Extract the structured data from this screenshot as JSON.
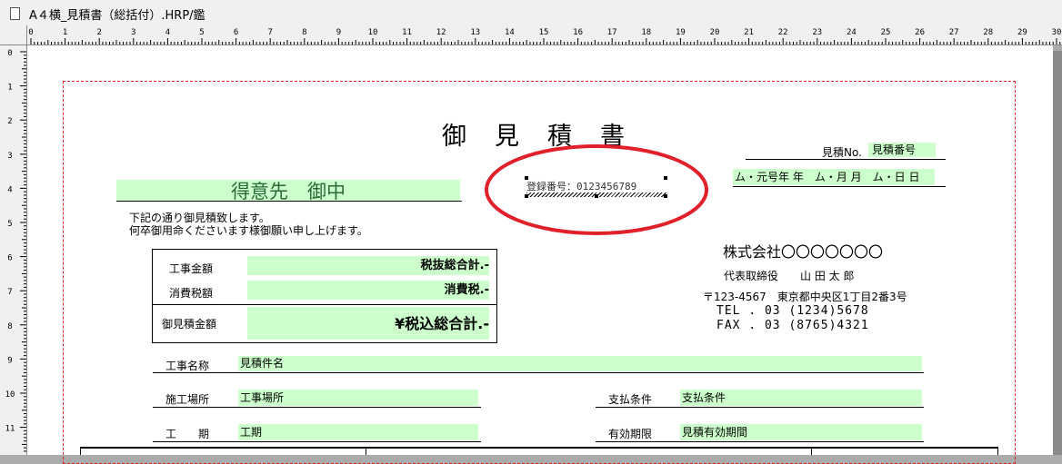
{
  "window": {
    "title": "A４横_見積書（総括付）.HRP/鑑"
  },
  "ruler": {
    "h_labels": [
      "0",
      "1",
      "2",
      "3",
      "4",
      "5",
      "6",
      "7",
      "8",
      "9",
      "10",
      "11",
      "12",
      "13",
      "14",
      "15",
      "16",
      "17",
      "18",
      "19",
      "20",
      "21",
      "22",
      "23",
      "24",
      "25",
      "26",
      "27",
      "28",
      "29",
      "30"
    ],
    "v_labels": [
      "0",
      "1",
      "2",
      "3",
      "4",
      "5",
      "6",
      "7",
      "8",
      "9",
      "10",
      "11"
    ]
  },
  "document": {
    "title": "御　見　積　書",
    "estimate_no_label": "見積No.",
    "estimate_no_field": "見積番号",
    "date_field": "ム・元号年 年　ム・月 月　ム・日 日",
    "registration_field": "登録番号：0123456789",
    "customer_field": "得意先　御中",
    "intro_line1": "下記の通り御見積致します。",
    "intro_line2": "何卒御用命くださいます様御願い申し上げます。",
    "amounts": {
      "construction_label": "工事金額",
      "construction_value": "税抜総合計.-",
      "tax_label": "消費税額",
      "tax_value": "消費税.-",
      "total_label": "御見積金額",
      "total_value": "¥税込総合計.-"
    },
    "company": {
      "name": "株式会社〇〇〇〇〇〇〇",
      "rep": "代表取締役　　山 田 太 郎",
      "address": "〒123-4567　東京都中央区1丁目2番3号",
      "tel": "TEL . 03 (1234)5678",
      "fax": "FAX . 03 (8765)4321"
    },
    "fields": {
      "project_name_label": "工事名称",
      "project_name_value": "見積件名",
      "site_label": "施工場所",
      "site_value": "工事場所",
      "payment_label": "支払条件",
      "payment_value": "支払条件",
      "period_label": "工　　期",
      "period_value": "工期",
      "validity_label": "有効期限",
      "validity_value": "見積有効期間"
    }
  },
  "colors": {
    "field_fill": "#ccffcc",
    "margin_line": "#e02020",
    "highlight_ellipse": "#e0202a"
  }
}
